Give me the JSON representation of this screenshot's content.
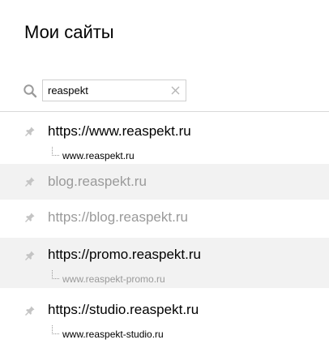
{
  "page": {
    "title": "Мои сайты"
  },
  "search": {
    "value": "reaspekt",
    "placeholder": ""
  },
  "sites": [
    {
      "url": "https://www.reaspekt.ru",
      "mirror": "www.reaspekt.ru",
      "disabled": false
    },
    {
      "url": "blog.reaspekt.ru",
      "mirror": "",
      "disabled": true
    },
    {
      "url": "https://blog.reaspekt.ru",
      "mirror": "",
      "disabled": true
    },
    {
      "url": "https://promo.reaspekt.ru",
      "mirror": "www.reaspekt-promo.ru",
      "disabled": false
    },
    {
      "url": "https://studio.reaspekt.ru",
      "mirror": "www.reaspekt-studio.ru",
      "disabled": false
    }
  ],
  "icons": {
    "search": "search-icon",
    "clear": "close-icon",
    "pin": "pin-icon"
  },
  "colors": {
    "text": "#000000",
    "muted": "#9a9a9a",
    "row_highlight": "#f2f2f2",
    "divider": "#d9d9d9"
  }
}
